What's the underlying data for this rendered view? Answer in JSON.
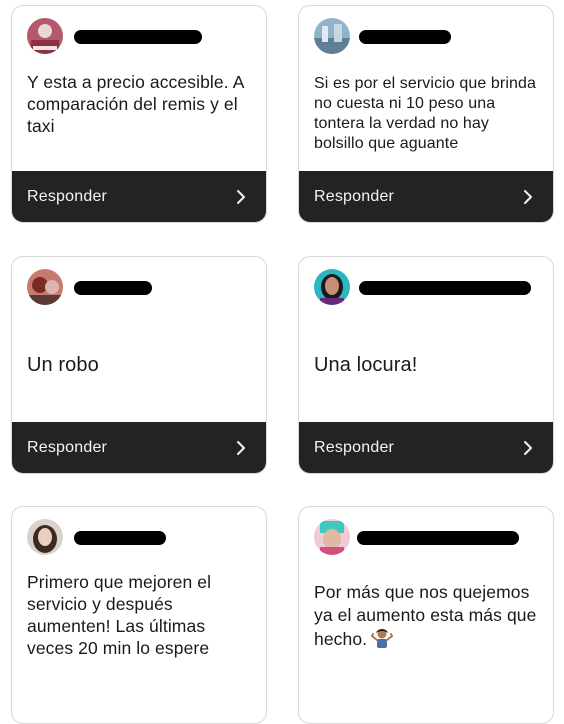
{
  "reply_label": "Responder",
  "cards": [
    {
      "text": "Y esta a precio accesible. A comparación del remis y el taxi",
      "username_hidden": true
    },
    {
      "text": "Si es por el servicio que brinda no cuesta  ni 10 peso una tontera la verdad no hay bolsillo que aguante",
      "username_hidden": true
    },
    {
      "text": "Un robo",
      "username_hidden": true
    },
    {
      "text": "Una locura!",
      "username_hidden": true
    },
    {
      "text": "Primero que mejoren el servicio y después aumenten! Las últimas veces 20 min lo espere",
      "username_hidden": true
    },
    {
      "text": "Por más que nos quejemos ya el aumento esta más que hecho.",
      "username_hidden": true,
      "emoji": "person-shrugging-icon"
    }
  ],
  "colors": {
    "reply_bar": "#232323",
    "card_border": "#d8d8d8",
    "text": "#1a1a1a"
  }
}
